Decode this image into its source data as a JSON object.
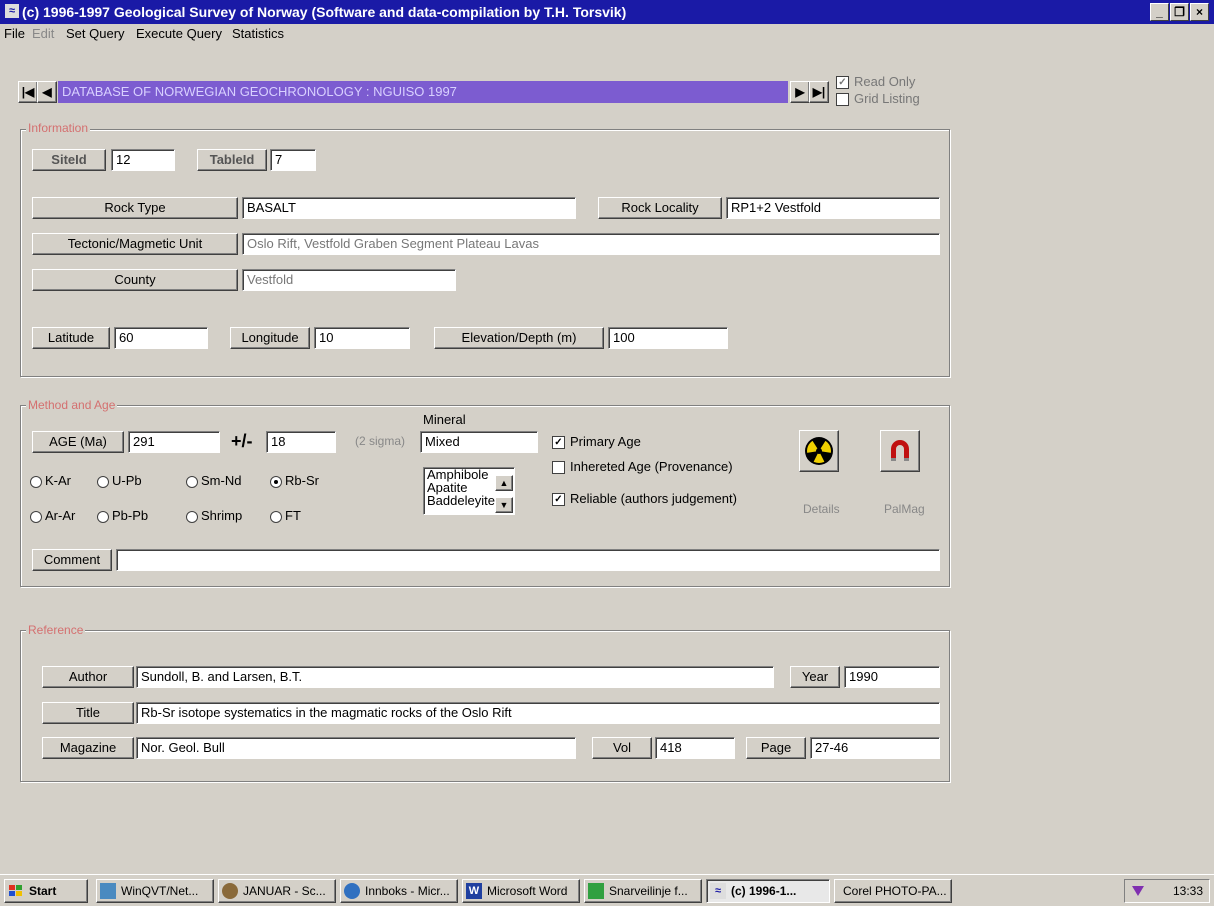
{
  "window": {
    "title": "(c) 1996-1997 Geological Survey of Norway (Software and data-compilation by T.H. Torsvik)",
    "controls": {
      "minimize": "_",
      "maximize": "Ɛ",
      "close": "×"
    }
  },
  "menu": {
    "file": "File",
    "edit": "Edit",
    "set_query": "Set Query",
    "execute_query": "Execute Query",
    "statistics": "Statistics"
  },
  "navigator": {
    "title": "DATABASE OF NORWEGIAN GEOCHRONOLOGY : NGUISO 1997",
    "first": "◀",
    "prev": "◀",
    "next": "▶",
    "last": "▶"
  },
  "options": {
    "read_only": {
      "label": "Read Only",
      "checked": true
    },
    "grid_listing": {
      "label": "Grid Listing",
      "checked": false
    }
  },
  "information": {
    "group_label": "Information",
    "site_id_label": "SiteId",
    "site_id": "12",
    "table_id_label": "TableId",
    "table_id": "7",
    "rock_type_label": "Rock Type",
    "rock_type": "BASALT",
    "rock_locality_label": "Rock Locality",
    "rock_locality": "RP1+2 Vestfold",
    "tectonic_label": "Tectonic/Magmetic Unit",
    "tectonic": "Oslo Rift, Vestfold Graben Segment Plateau Lavas",
    "county_label": "County",
    "county": "Vestfold",
    "latitude_label": "Latitude",
    "latitude": "60",
    "longitude_label": "Longitude",
    "longitude": "10",
    "elevation_label": "Elevation/Depth (m)",
    "elevation": "100"
  },
  "method": {
    "group_label": "Method and Age",
    "age_label": "AGE (Ma)",
    "age": "291",
    "plusminus_label": "+/-",
    "error": "18",
    "sigma_label": "(2 sigma)",
    "mineral_label": "Mineral",
    "mineral": "Mixed",
    "mineral_list": [
      "Amphibole",
      "Apatite",
      "Baddeleyite"
    ],
    "radios": {
      "k_ar": "K-Ar",
      "u_pb": "U-Pb",
      "sm_nd": "Sm-Nd",
      "rb_sr": "Rb-Sr",
      "ar_ar": "Ar-Ar",
      "pb_pb": "Pb-Pb",
      "shrimp": "Shrimp",
      "ft": "FT"
    },
    "selected_method": "Rb-Sr",
    "primary_age": {
      "label": "Primary Age",
      "checked": true
    },
    "inherited_age": {
      "label": "Inhereted Age (Provenance)",
      "checked": false
    },
    "reliable": {
      "label": "Reliable (authors judgement)",
      "checked": true
    },
    "details_label": "Details",
    "palmag_label": "PalMag",
    "comment_label": "Comment",
    "comment": ""
  },
  "reference": {
    "group_label": "Reference",
    "author_label": "Author",
    "author": "Sundoll, B. and Larsen, B.T.",
    "year_label": "Year",
    "year": "1990",
    "title_label": "Title",
    "title": "Rb-Sr isotope systematics in the magmatic rocks of the Oslo Rift",
    "magazine_label": "Magazine",
    "magazine": "Nor. Geol. Bull",
    "vol_label": "Vol",
    "vol": "418",
    "page_label": "Page",
    "page": "27-46"
  },
  "taskbar": {
    "start": "Start",
    "items": [
      "WinQVT/Net...",
      "JANUAR - Sc...",
      "Innboks - Micr...",
      "Microsoft Word",
      "Snarveilinje f...",
      "(c) 1996-1...",
      "Corel PHOTO-PA..."
    ],
    "clock": "13:33"
  },
  "colors": {
    "title_bar": "#1a1aa6",
    "navigator_bar": "#7c5cd0",
    "group_label": "#d47070",
    "window_bg": "#d4d0c8"
  }
}
